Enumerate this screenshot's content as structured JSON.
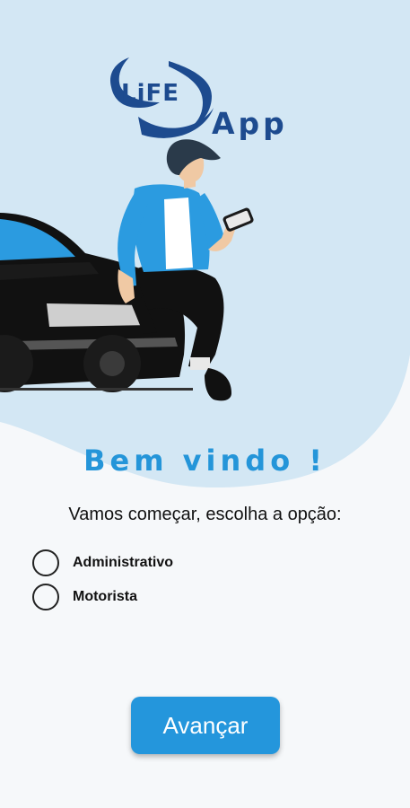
{
  "logo": {
    "brand": "LiFE",
    "suffix": "App"
  },
  "welcome": {
    "title": "Bem vindo !"
  },
  "prompt": {
    "text": "Vamos começar, escolha a opção:"
  },
  "options": [
    {
      "label": "Administrativo",
      "selected": false
    },
    {
      "label": "Motorista",
      "selected": false
    }
  ],
  "actions": {
    "next_label": "Avançar"
  },
  "colors": {
    "accent": "#2496dc",
    "background_blob": "#d3e7f4",
    "logo_navy": "#1d4b8f"
  }
}
